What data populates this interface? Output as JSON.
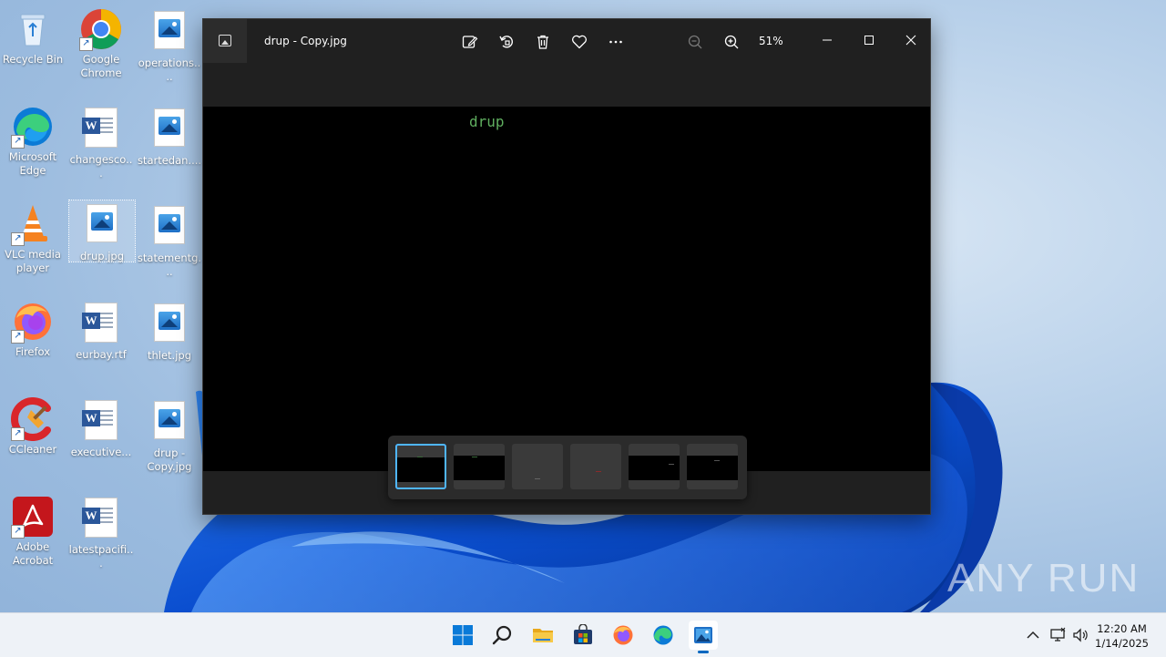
{
  "desktop": {
    "icons": [
      {
        "label": "Recycle Bin"
      },
      {
        "label": "Google Chrome"
      },
      {
        "label": "operations...."
      },
      {
        "label": "Microsoft Edge"
      },
      {
        "label": "changesco..."
      },
      {
        "label": "startedan...."
      },
      {
        "label": "VLC media player"
      },
      {
        "label": "drup.jpg"
      },
      {
        "label": "statementg..."
      },
      {
        "label": "Firefox"
      },
      {
        "label": "eurbay.rtf"
      },
      {
        "label": "thlet.jpg"
      },
      {
        "label": "CCleaner"
      },
      {
        "label": "executive..."
      },
      {
        "label": "drup - Copy.jpg"
      },
      {
        "label": "Adobe Acrobat"
      },
      {
        "label": "latestpacifi..."
      }
    ]
  },
  "photos": {
    "title": "drup - Copy.jpg",
    "zoom": "51%",
    "image_text": "drup",
    "toolbar": [
      "edit-icon",
      "rotate-icon",
      "delete-icon",
      "favorite-icon",
      "more-icon"
    ],
    "filmstrip": {
      "count": 6,
      "selected_index": 0
    }
  },
  "watermark": {
    "text": "ANY RUN"
  },
  "taskbar": {
    "apps": [
      "start-icon",
      "search-icon",
      "file-explorer-icon",
      "store-icon",
      "firefox-icon",
      "edge-icon",
      "photos-icon"
    ],
    "clock": {
      "time": "12:20 AM",
      "date": "1/14/2025"
    }
  },
  "colors": {
    "accent": "#0067c0",
    "selection": "#4fb6ff",
    "image_text": "#5fae5f"
  }
}
